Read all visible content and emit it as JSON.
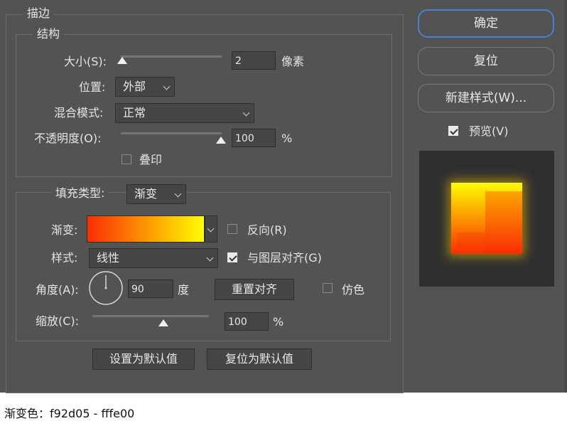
{
  "dialog_title": "描边",
  "structure": {
    "legend": "结构",
    "size_label": "大小(S):",
    "size_value": "2",
    "size_unit": "像素",
    "position_label": "位置:",
    "position_value": "外部",
    "blend_label": "混合模式:",
    "blend_value": "正常",
    "opacity_label": "不透明度(O):",
    "opacity_value": "100",
    "opacity_unit": "%",
    "overprint_label": "叠印"
  },
  "fill": {
    "type_label": "填充类型:",
    "type_value": "渐变",
    "gradient_label": "渐变:",
    "reverse_label": "反向(R)",
    "style_label": "样式:",
    "style_value": "线性",
    "align_label": "与图层对齐(G)",
    "angle_label": "角度(A):",
    "angle_value": "90",
    "angle_unit": "度",
    "reset_align_label": "重置对齐",
    "dither_label": "仿色",
    "scale_label": "缩放(C):",
    "scale_value": "100",
    "scale_unit": "%"
  },
  "bottom_buttons": {
    "set_default": "设置为默认值",
    "reset_default": "复位为默认值"
  },
  "side": {
    "ok": "确定",
    "reset": "复位",
    "new_style": "新建样式(W)...",
    "preview_label": "预览(V)"
  },
  "states": {
    "overprint_checked": false,
    "reverse_checked": false,
    "align_checked": true,
    "dither_checked": false,
    "preview_checked": true,
    "size_slider_fraction": 0.02,
    "opacity_slider_fraction": 1.0,
    "scale_slider_fraction": 0.6
  },
  "colors": {
    "gradient_start": "#f92d05",
    "gradient_end": "#fffe00",
    "accent": "#4d7fd1"
  },
  "caption": "渐变色：f92d05 - fffe00"
}
